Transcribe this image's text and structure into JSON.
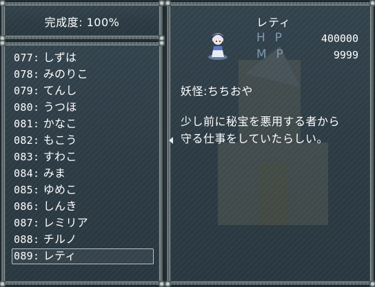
{
  "completion": {
    "label": "完成度:",
    "value": "100%"
  },
  "character_list": [
    {
      "num": "077:",
      "name": "しずは"
    },
    {
      "num": "078:",
      "name": "みのりこ"
    },
    {
      "num": "079:",
      "name": "てんし"
    },
    {
      "num": "080:",
      "name": "うつほ"
    },
    {
      "num": "081:",
      "name": "かなこ"
    },
    {
      "num": "082:",
      "name": "もこう"
    },
    {
      "num": "083:",
      "name": "すわこ"
    },
    {
      "num": "084:",
      "name": "みま"
    },
    {
      "num": "085:",
      "name": "ゆめこ"
    },
    {
      "num": "086:",
      "name": "しんき"
    },
    {
      "num": "087:",
      "name": "レミリア"
    },
    {
      "num": "088:",
      "name": "チルノ"
    },
    {
      "num": "089:",
      "name": "レティ"
    }
  ],
  "selected_index": 12,
  "detail": {
    "name": "レティ",
    "hp_label": "HP",
    "hp_value": "400000",
    "mp_label": "MP",
    "mp_value": "9999",
    "kind": "妖怪:ちちおや",
    "description_lines": [
      "少し前に秘宝を悪用する者から",
      "守る仕事をしていたらしい。"
    ]
  },
  "colors": {
    "window_fill": "#2f3e47",
    "window_border": "#5f6c6f",
    "stat_label": "#7f9ab0",
    "text": "#ffffff"
  }
}
